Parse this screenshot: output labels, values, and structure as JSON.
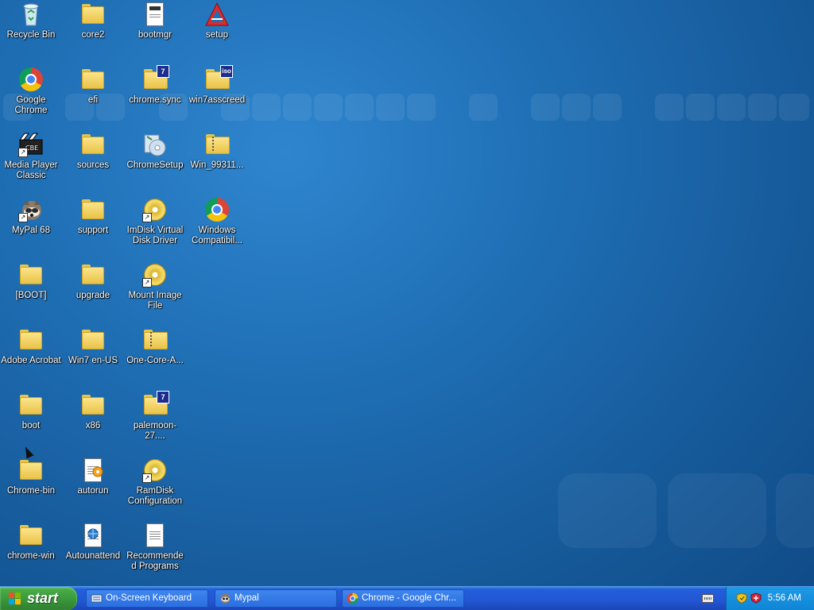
{
  "desktop": {
    "icons": [
      {
        "label": "Recycle Bin",
        "icon": "recycle-bin-icon"
      },
      {
        "label": "Google Chrome",
        "icon": "chrome-icon"
      },
      {
        "label": "Media Player Classic",
        "icon": "media-player-icon"
      },
      {
        "label": "MyPal 68",
        "icon": "mypal-icon"
      },
      {
        "label": "[BOOT]",
        "icon": "folder-icon"
      },
      {
        "label": "Adobe Acrobat",
        "icon": "folder-icon"
      },
      {
        "label": "boot",
        "icon": "folder-icon"
      },
      {
        "label": "Chrome-bin",
        "icon": "folder-icon"
      },
      {
        "label": "chrome-win",
        "icon": "folder-icon"
      },
      {
        "label": "core2",
        "icon": "folder-icon"
      },
      {
        "label": "efi",
        "icon": "folder-icon"
      },
      {
        "label": "sources",
        "icon": "folder-icon"
      },
      {
        "label": "support",
        "icon": "folder-icon"
      },
      {
        "label": "upgrade",
        "icon": "folder-icon"
      },
      {
        "label": "Win7 en-US",
        "icon": "folder-icon"
      },
      {
        "label": "x86",
        "icon": "folder-icon"
      },
      {
        "label": "autorun",
        "icon": "autorun-icon"
      },
      {
        "label": "Autounattend",
        "icon": "xml-document-icon"
      },
      {
        "label": "bootmgr",
        "icon": "system-file-icon"
      },
      {
        "label": "chrome.sync",
        "icon": "7zip-archive-icon"
      },
      {
        "label": "ChromeSetup",
        "icon": "setup-disc-icon"
      },
      {
        "label": "ImDisk Virtual Disk Driver",
        "icon": "disc-icon"
      },
      {
        "label": "Mount Image File",
        "icon": "disc-icon"
      },
      {
        "label": "One-Core-A...",
        "icon": "zip-folder-icon"
      },
      {
        "label": "palemoon-27....",
        "icon": "7zip-archive-icon"
      },
      {
        "label": "RamDisk Configuration",
        "icon": "disc-icon"
      },
      {
        "label": "Recommended Programs",
        "icon": "text-document-icon"
      },
      {
        "label": "setup",
        "icon": "setup-triangle-icon"
      },
      {
        "label": "win7asscreed",
        "icon": "iso-archive-icon"
      },
      {
        "label": "Win_99311...",
        "icon": "zip-folder-icon"
      },
      {
        "label": "Windows Compatibil...",
        "icon": "chrome-icon"
      }
    ]
  },
  "taskbar": {
    "start_label": "start",
    "tasks": [
      {
        "label": "On-Screen Keyboard",
        "icon": "keyboard-icon"
      },
      {
        "label": "Mypal",
        "icon": "mypal-icon"
      },
      {
        "label": "Chrome - Google Chr...",
        "icon": "chrome-icon"
      }
    ],
    "clock": "5:56 AM"
  },
  "colors": {
    "desktop_blue": "#1f6fb5",
    "taskbar_blue": "#245edb",
    "start_green": "#3c9a3c"
  }
}
